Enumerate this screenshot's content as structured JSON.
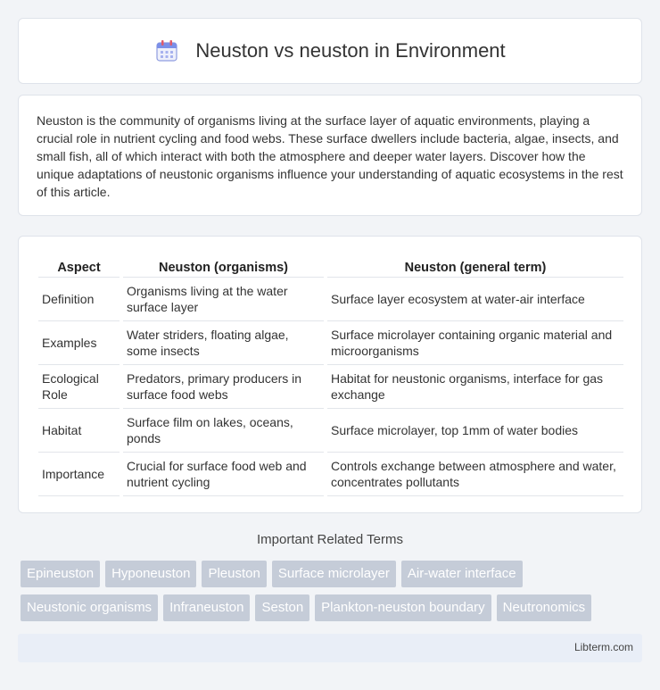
{
  "header": {
    "title": "Neuston vs neuston in Environment",
    "icon": "calendar-icon"
  },
  "intro": {
    "text": "Neuston is the community of organisms living at the surface layer of aquatic environments, playing a crucial role in nutrient cycling and food webs. These surface dwellers include bacteria, algae, insects, and small fish, all of which interact with both the atmosphere and deeper water layers. Discover how the unique adaptations of neustonic organisms influence your understanding of aquatic ecosystems in the rest of this article."
  },
  "table": {
    "headers": [
      "Aspect",
      "Neuston (organisms)",
      "Neuston (general term)"
    ],
    "rows": [
      [
        "Definition",
        "Organisms living at the water surface layer",
        "Surface layer ecosystem at water-air interface"
      ],
      [
        "Examples",
        "Water striders, floating algae, some insects",
        "Surface microlayer containing organic material and microorganisms"
      ],
      [
        "Ecological Role",
        "Predators, primary producers in surface food webs",
        "Habitat for neustonic organisms, interface for gas exchange"
      ],
      [
        "Habitat",
        "Surface film on lakes, oceans, ponds",
        "Surface microlayer, top 1mm of water bodies"
      ],
      [
        "Importance",
        "Crucial for surface food web and nutrient cycling",
        "Controls exchange between atmosphere and water, concentrates pollutants"
      ]
    ]
  },
  "related": {
    "title": "Important Related Terms",
    "row1": [
      "Epineuston",
      "Hyponeuston",
      "Pleuston",
      "Surface microlayer",
      "Air-water interface"
    ],
    "row2": [
      "Neustonic organisms",
      "Infraneuston",
      "Seston",
      "Plankton-neuston boundary",
      "Neutronomics"
    ]
  },
  "footer": {
    "site": "Libterm.com"
  },
  "colors": {
    "tag_bg": "#c5ccd8",
    "footer_bg": "#e9eef7",
    "page_bg": "#f2f4f7"
  }
}
